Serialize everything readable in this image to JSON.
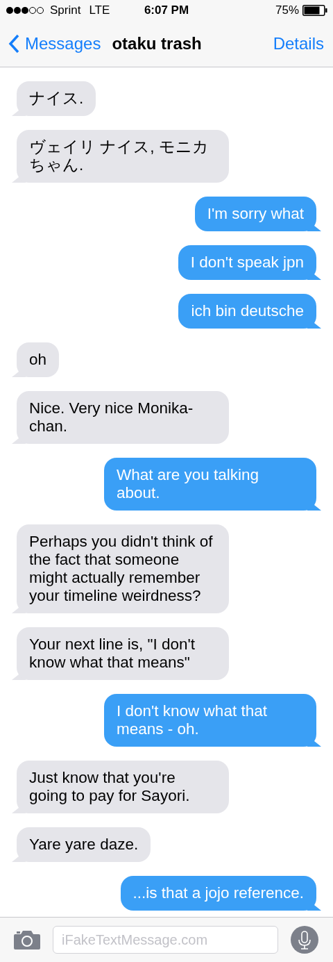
{
  "status_bar": {
    "carrier": "Sprint",
    "network": "LTE",
    "time": "6:07 PM",
    "battery": "75%"
  },
  "nav": {
    "back": "Messages",
    "title": "otaku trash",
    "action": "Details"
  },
  "messages": [
    {
      "kind": "received",
      "text": "ナイス."
    },
    {
      "kind": "received",
      "text": "ヴェイリ ナイス, モニカちゃん."
    },
    {
      "kind": "sent",
      "text": "I'm sorry what"
    },
    {
      "kind": "sent",
      "text": "I don't speak jpn"
    },
    {
      "kind": "sent",
      "text": "ich bin deutsche"
    },
    {
      "kind": "received",
      "text": "oh"
    },
    {
      "kind": "received",
      "text": "Nice. Very nice Monika-chan."
    },
    {
      "kind": "sent",
      "text": "What are you talking about."
    },
    {
      "kind": "received",
      "text": "Perhaps you didn't think of the fact that someone might actually remember your timeline weirdness?"
    },
    {
      "kind": "received",
      "text": "Your next line is, \"I don't know what that means\""
    },
    {
      "kind": "sent",
      "text": "I don't know what that means - oh."
    },
    {
      "kind": "received",
      "text": "Just know that you're going to pay for Sayori."
    },
    {
      "kind": "received",
      "text": "Yare yare daze."
    },
    {
      "kind": "sent",
      "text": "...is that a jojo reference."
    }
  ],
  "input": {
    "placeholder": "iFakeTextMessage.com"
  }
}
